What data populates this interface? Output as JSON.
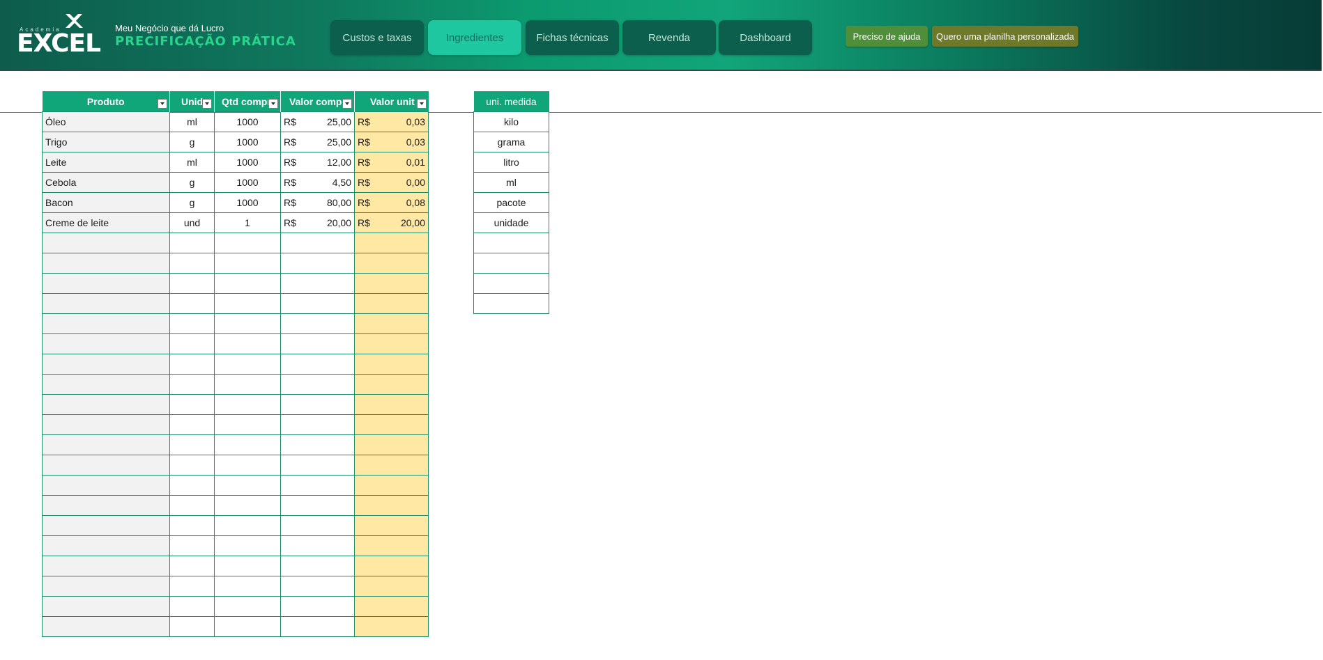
{
  "header": {
    "logo_top": "Academia",
    "logo_main": "EXCEL",
    "brand_subtitle": "Meu Negócio que dá Lucro",
    "brand_title": "PRECIFICAÇÃO PRÁTICA",
    "tabs": [
      {
        "label": "Custos e taxas",
        "active": false
      },
      {
        "label": "Ingredientes",
        "active": true
      },
      {
        "label": "Fichas técnicas",
        "active": false
      },
      {
        "label": "Revenda",
        "active": false
      },
      {
        "label": "Dashboard",
        "active": false
      }
    ],
    "help_button": "Preciso de ajuda",
    "custom_button": "Quero uma planilha personalizada",
    "colors": {
      "help": "#4f8f3a",
      "custom": "#6e7a2a",
      "active_tab": "#1fc7a1"
    }
  },
  "ingredients": {
    "headers": [
      "Produto",
      "Unid",
      "Qtd compr",
      "Valor compr",
      "Valor unit"
    ],
    "currency": "R$",
    "rows": [
      {
        "produto": "Óleo",
        "unid": "ml",
        "qtd": "1000",
        "valor_compra": "25,00",
        "valor_unit": "0,03"
      },
      {
        "produto": "Trigo",
        "unid": "g",
        "qtd": "1000",
        "valor_compra": "25,00",
        "valor_unit": "0,03"
      },
      {
        "produto": "Leite",
        "unid": "ml",
        "qtd": "1000",
        "valor_compra": "12,00",
        "valor_unit": "0,01"
      },
      {
        "produto": "Cebola",
        "unid": "g",
        "qtd": "1000",
        "valor_compra": "4,50",
        "valor_unit": "0,00"
      },
      {
        "produto": "Bacon",
        "unid": "g",
        "qtd": "1000",
        "valor_compra": "80,00",
        "valor_unit": "0,08"
      },
      {
        "produto": "Creme de leite",
        "unid": "und",
        "qtd": "1",
        "valor_compra": "20,00",
        "valor_unit": "20,00"
      }
    ]
  },
  "units": {
    "header": "uni. medida",
    "items": [
      "kilo",
      "grama",
      "litro",
      "ml",
      "pacote",
      "unidade"
    ]
  }
}
